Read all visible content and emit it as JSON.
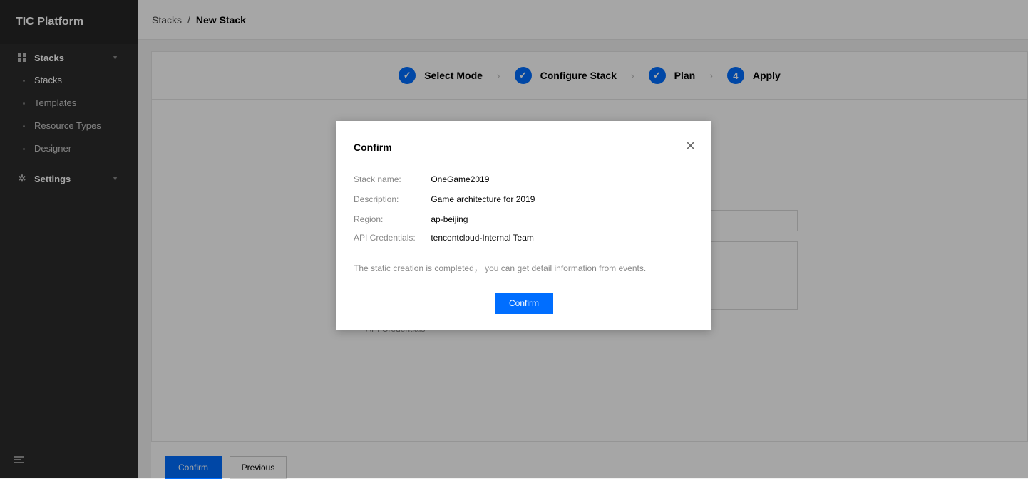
{
  "sidebar": {
    "brand": "TIC Platform",
    "groups": [
      {
        "label": "Stacks",
        "icon": "grid-icon",
        "items": [
          {
            "label": "Stacks",
            "active": true
          },
          {
            "label": "Templates"
          },
          {
            "label": "Resource Types"
          },
          {
            "label": "Designer"
          }
        ]
      },
      {
        "label": "Settings",
        "icon": "gear-icon"
      }
    ],
    "bottom_icon": "collapse-menu-icon"
  },
  "breadcrumb": {
    "parent": "Stacks",
    "separator": "/",
    "current": "New Stack"
  },
  "steps": [
    {
      "label": "Select Mode",
      "state": "done"
    },
    {
      "label": "Configure Stack",
      "state": "done"
    },
    {
      "label": "Plan",
      "state": "done"
    },
    {
      "label": "Apply",
      "state": "current",
      "number": "4"
    }
  ],
  "footer": {
    "confirm_label": "Confirm",
    "previous_label": "Previous"
  },
  "background": {
    "partial_label": "API Credentials"
  },
  "modal": {
    "title": "Confirm",
    "fields": [
      {
        "key": "Stack name:",
        "value": "OneGame2019"
      },
      {
        "key": "Description:",
        "value": "Game architecture for 2019"
      },
      {
        "key": "Region:",
        "value": "ap-beijing"
      },
      {
        "key": "API Credentials:",
        "value": "tencentcloud-Internal Team"
      }
    ],
    "message": "The static creation is completed， you can get detail information from events.",
    "confirm_label": "Confirm"
  },
  "colors": {
    "accent": "#006eff",
    "sidebar_bg": "#2b2b2b"
  }
}
